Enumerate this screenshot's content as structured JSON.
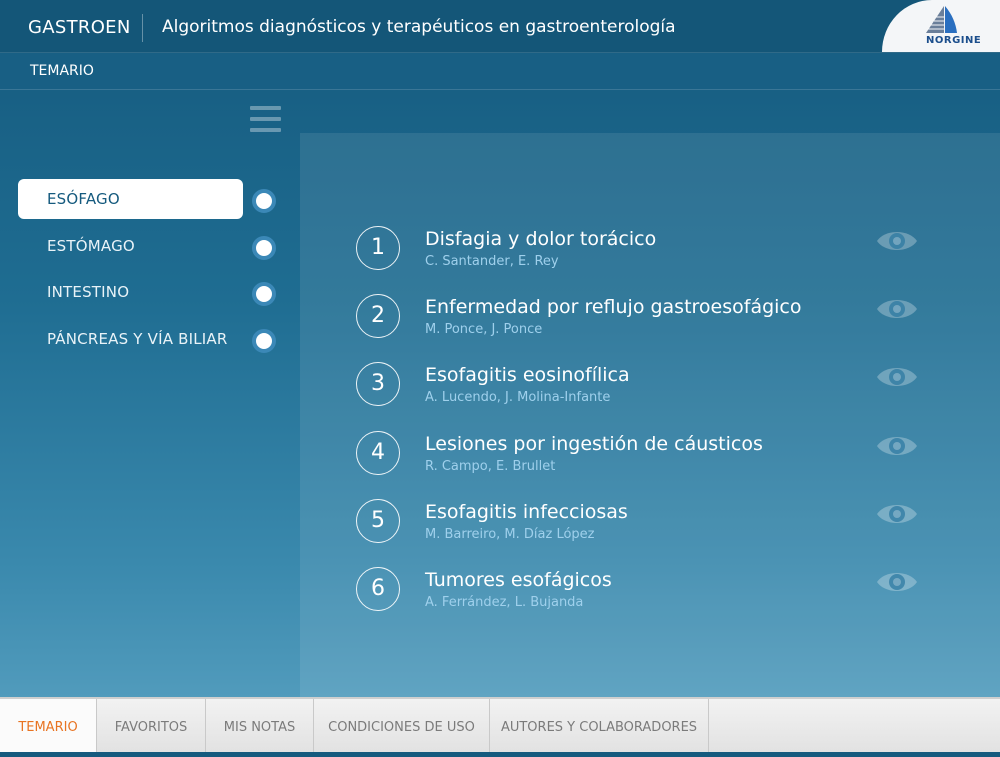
{
  "header": {
    "app_name": "GASTROEN",
    "subtitle": "Algoritmos diagnósticos y terapéuticos en gastroenterología",
    "logo_text": "NORGINE"
  },
  "section": {
    "title": "TEMARIO"
  },
  "sidebar": {
    "items": [
      {
        "label": "ESÓFAGO",
        "active": true
      },
      {
        "label": "ESTÓMAGO",
        "active": false
      },
      {
        "label": "INTESTINO",
        "active": false
      },
      {
        "label": "PÁNCREAS Y VÍA BILIAR",
        "active": false
      }
    ]
  },
  "topics": [
    {
      "number": "1",
      "title": "Disfagia y dolor torácico",
      "authors": "C. Santander, E. Rey"
    },
    {
      "number": "2",
      "title": "Enfermedad por reflujo gastroesofágico",
      "authors": "M. Ponce, J. Ponce"
    },
    {
      "number": "3",
      "title": "Esofagitis eosinofílica",
      "authors": "A. Lucendo, J. Molina-Infante"
    },
    {
      "number": "4",
      "title": "Lesiones por ingestión de cáusticos",
      "authors": "R. Campo, E. Brullet"
    },
    {
      "number": "5",
      "title": "Esofagitis infecciosas",
      "authors": "M. Barreiro, M. Díaz López"
    },
    {
      "number": "6",
      "title": "Tumores esofágicos",
      "authors": "A. Ferrández, L. Bujanda"
    }
  ],
  "tabs": [
    {
      "label": "TEMARIO",
      "active": true
    },
    {
      "label": "FAVORITOS",
      "active": false
    },
    {
      "label": "MIS NOTAS",
      "active": false
    },
    {
      "label": "CONDICIONES DE USO",
      "active": false
    },
    {
      "label": "AUTORES Y COLABORADORES",
      "active": false
    }
  ],
  "colors": {
    "header_bg": "#145678",
    "accent_tab": "#e87422",
    "author_text": "#9fd0ec"
  },
  "icons": {
    "menu": "hamburger-icon",
    "view": "eye-icon",
    "logo": "sail-logo"
  }
}
